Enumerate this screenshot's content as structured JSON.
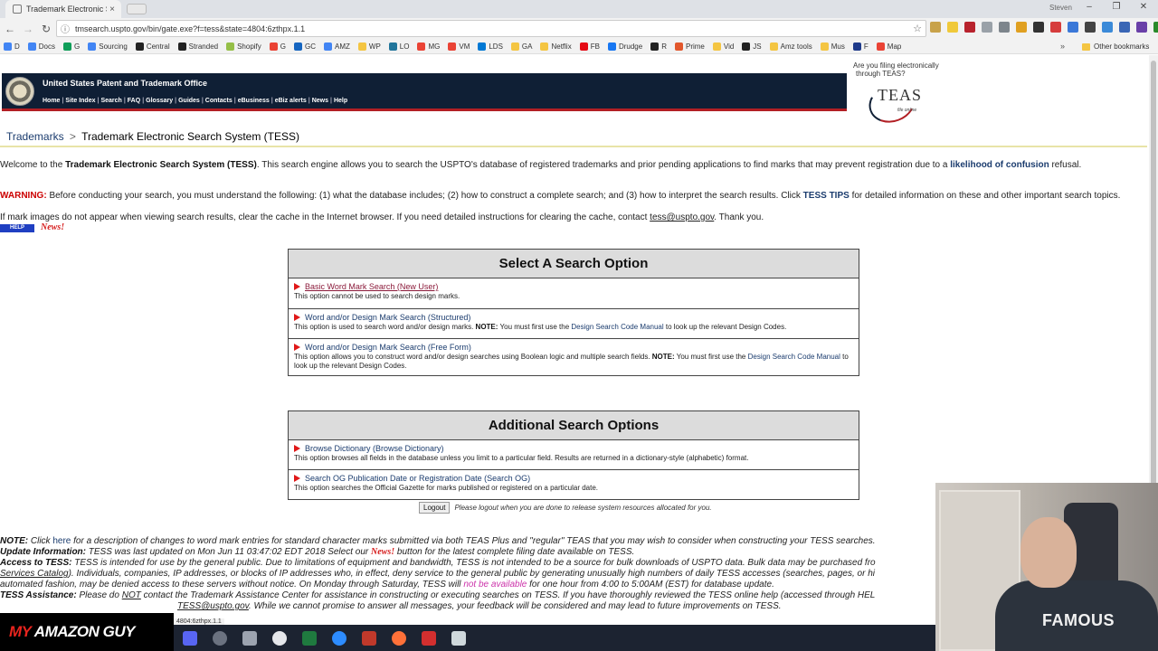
{
  "browser": {
    "tab_title": "Trademark Electronic Se",
    "tab_close": "×",
    "url": "tmsearch.uspto.gov/bin/gate.exe?f=tess&state=4804:6zthpx.1.1",
    "user_name": "Steven",
    "status_url": "4804:6zthpx.1.1",
    "bookmarks": [
      "D",
      "Docs",
      "G",
      "Sourcing",
      "Central",
      "Stranded",
      "Shopify",
      "G",
      "GC",
      "AMZ",
      "WP",
      "LO",
      "MG",
      "VM",
      "LDS",
      "GA",
      "Netflix",
      "FB",
      "Drudge",
      "R",
      "Prime",
      "Vid",
      "JS",
      "Amz tools",
      "Mus",
      "F",
      "Map"
    ],
    "bookmarks_more": "»",
    "other_bookmarks": "Other bookmarks"
  },
  "banner": {
    "org": "United States Patent and Trademark Office",
    "nav": [
      "Home",
      "Site Index",
      "Search",
      "FAQ",
      "Glossary",
      "Guides",
      "Contacts",
      "eBusiness",
      "eBiz alerts",
      "News",
      "Help"
    ]
  },
  "teas": {
    "ask_line1": "Are you filing electronically",
    "ask_line2": "through TEAS?",
    "logo": "TEAS",
    "logo_sub": "file online"
  },
  "breadcrumb": {
    "home": "Trademarks",
    "sep": ">",
    "current": "Trademark Electronic Search System (TESS)"
  },
  "intro": {
    "welcome_pre": "Welcome to the ",
    "welcome_bold": "Trademark Electronic Search System (TESS)",
    "welcome_mid": ". This search engine allows you to search the USPTO's database of registered trademarks and prior pending applications to find marks that may prevent registration due to a ",
    "welcome_link": "likelihood of confusion",
    "welcome_end": " refusal.",
    "warning_label": "WARNING:",
    "warning_text": " Before conducting your search, you must understand the following: (1) what the database includes; (2) how to construct a complete search; and (3) how to interpret the search results. Click ",
    "warning_link": "TESS TIPS",
    "warning_end": " for detailed information on these and other important search topics.",
    "cache_text": "If mark images do not appear when viewing search results, clear the cache in the Internet browser. If you need detailed instructions for clearing the cache, contact ",
    "cache_email": "tess@uspto.gov",
    "cache_end": ". Thank you.",
    "help_label": "HELP",
    "news_label": "News!"
  },
  "search_options": {
    "title": "Select A Search Option",
    "items": [
      {
        "label": "Basic Word Mark Search (New User)",
        "desc": "This option cannot be used to search design marks."
      },
      {
        "label": "Word and/or Design Mark Search (Structured)",
        "desc_pre": "This option is used to search word and/or design marks. ",
        "note": "NOTE:",
        "desc_mid": " You must first use the ",
        "desc_link": "Design Search Code Manual",
        "desc_end": " to look up the relevant Design Codes."
      },
      {
        "label": "Word and/or Design Mark Search (Free Form)",
        "desc_pre": "This option allows you to construct word and/or design searches using Boolean logic and multiple search fields. ",
        "note": "NOTE:",
        "desc_mid": " You must first use the ",
        "desc_link": "Design Search Code Manual",
        "desc_end": " to look up the relevant Design Codes."
      }
    ]
  },
  "additional_options": {
    "title": "Additional Search Options",
    "items": [
      {
        "label": "Browse Dictionary (Browse Dictionary)",
        "desc": "This option browses all fields in the database unless you limit to a particular field. Results are returned in a dictionary-style (alphabetic) format."
      },
      {
        "label": "Search OG Publication Date or Registration Date (Search OG)",
        "desc": "This option searches the Official Gazette for marks published or registered on a particular date."
      }
    ]
  },
  "logout": {
    "button": "Logout",
    "note": "Please logout when you are done to release system resources allocated for you."
  },
  "footer": {
    "note_label": "NOTE:",
    "note_pre": " Click ",
    "note_link": "here",
    "note_text": " for a description of changes to word mark entries for standard character marks submitted via both TEAS Plus and \"regular\" TEAS that you may wish to consider when constructing your TESS searches.",
    "update_label": "Update Information:",
    "update_text": " TESS was last updated on Mon Jun 11 03:47:02 EDT 2018 Select our ",
    "update_news": "News!",
    "update_end": " button for the latest complete filing date available on TESS.",
    "access_label": "Access to TESS:",
    "access_text": " TESS is intended for use by the general public. Due to limitations of equipment and bandwidth, TESS is not intended to be a source for bulk downloads of USPTO data. Bulk data may be purchased fro",
    "access_line2_link": "Services Catalog",
    "access_line2": "). Individuals, companies, IP addresses, or blocks of IP addresses who, in effect, deny service to the general public by generating unusually high numbers of daily TESS accesses (searches, pages, or hi",
    "access_line3": "automated fashion, may be denied access to these servers without notice. On Monday through Saturday, TESS will ",
    "access_line3_red": "not be available",
    "access_line3_end": " for one hour from 4:00 to 5:00AM (EST) for database update.",
    "assist_label": "TESS Assistance:",
    "assist_text_pre": " Please do ",
    "assist_not": "NOT",
    "assist_text": " contact the Trademark Assistance Center for assistance in constructing or executing searches on TESS. If you have thoroughly reviewed the TESS online help (accessed through HEL",
    "assist_line2_email": "TESS@uspto.gov",
    "assist_line2": ". While we cannot promise to answer all messages, your feedback will be considered and may lead to future improvements on TESS."
  },
  "overlay": {
    "brand_my": "MY",
    "brand_rest": " AMAZON GUY",
    "shirt_text": "FAMOUS"
  }
}
